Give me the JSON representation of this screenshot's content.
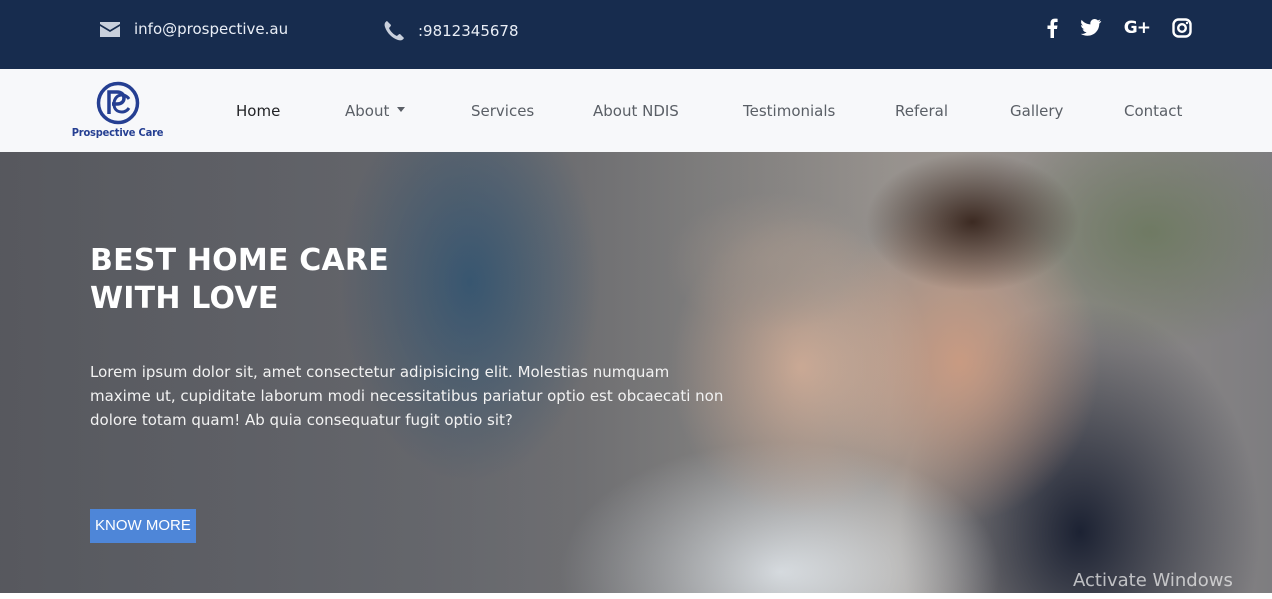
{
  "topbar": {
    "email": "info@prospective.au",
    "phone": ":9812345678",
    "email_icon": "envelope-icon",
    "phone_icon": "phone-icon",
    "social_icons": [
      "facebook-icon",
      "twitter-icon",
      "google-plus-icon",
      "instagram-icon"
    ],
    "gplus_text": "G+",
    "background_color": "#172c4e"
  },
  "navbar": {
    "logo_text": "Prospective Care",
    "items": [
      {
        "label": "Home",
        "active": true
      },
      {
        "label": "About",
        "dropdown": true
      },
      {
        "label": "Services"
      },
      {
        "label": "About NDIS"
      },
      {
        "label": "Testimonials"
      },
      {
        "label": "Referal"
      },
      {
        "label": "Gallery"
      },
      {
        "label": "Contact"
      }
    ]
  },
  "hero": {
    "title_line1": "BEST HOME CARE",
    "title_line2": "WITH LOVE",
    "lead": "Lorem ipsum dolor sit, amet consectetur adipisicing elit. Molestias numquam maxime ut, cupiditate laborum modi necessitatibus pariatur optio est obcaecati non dolore totam quam! Ab quia consequatur fugit optio sit?",
    "button_label": "KNOW MORE",
    "button_color": "#4e86d8"
  },
  "overlay": {
    "watermark": "Activate Windows"
  }
}
